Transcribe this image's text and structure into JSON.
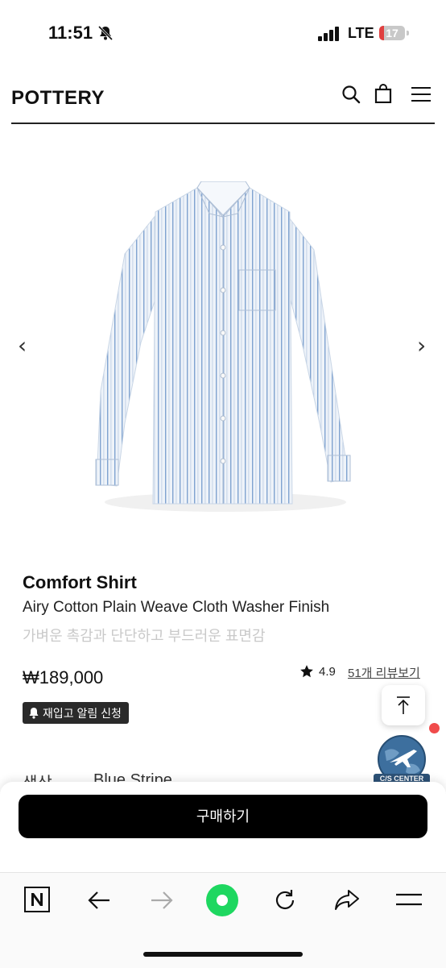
{
  "status_bar": {
    "time": "11:51",
    "network": "LTE",
    "battery": "17"
  },
  "header": {
    "logo": "POTTERY",
    "icons": [
      "search-icon",
      "shopping-bag-icon",
      "menu-icon"
    ]
  },
  "gallery": {
    "prev": "‹",
    "next": "›"
  },
  "product": {
    "name": "Comfort Shirt",
    "subtitle": "Airy Cotton Plain Weave Cloth Washer Finish",
    "description": "가벼운 촉감과 단단하고 부드러운 표면감",
    "price": "₩189,000",
    "rating": "4.9",
    "reviews_link": "51개 리뷰보기",
    "restock_label": "재입고 알림 신청"
  },
  "option": {
    "label": "색상",
    "value": "Blue Stripe"
  },
  "cs_badge": "C/S CENTER",
  "buy_button": "구매하기",
  "colors": {
    "accent": "#000000",
    "red_dot": "#f04b4b",
    "green_home": "#1ed760"
  }
}
